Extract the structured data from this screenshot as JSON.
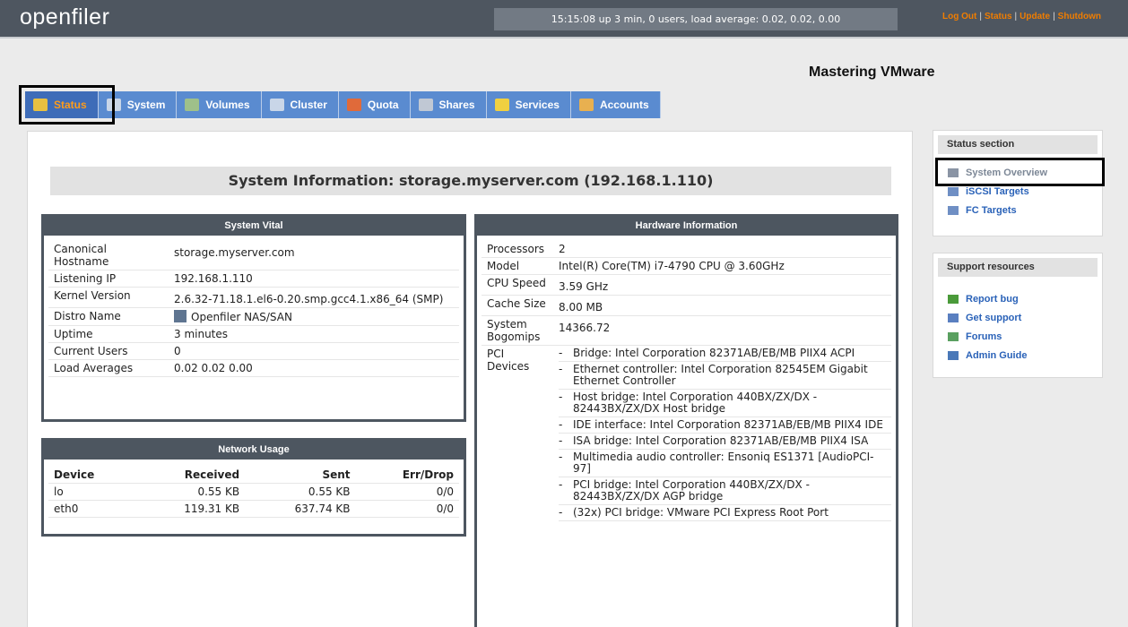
{
  "header": {
    "logo": "openfiler",
    "uptime": "15:15:08 up 3 min, 0 users, load average: 0.02, 0.02, 0.00",
    "links": [
      "Log Out",
      "Status",
      "Update",
      "Shutdown"
    ]
  },
  "page_title": "Mastering VMware",
  "tabs": [
    {
      "label": "Status",
      "icon": "status-icon",
      "color": "#e8c040"
    },
    {
      "label": "System",
      "icon": "system-icon",
      "color": "#c9d6e8"
    },
    {
      "label": "Volumes",
      "icon": "volumes-icon",
      "color": "#9fc08a"
    },
    {
      "label": "Cluster",
      "icon": "cluster-icon",
      "color": "#c9d6e8"
    },
    {
      "label": "Quota",
      "icon": "quota-icon",
      "color": "#e06a3a"
    },
    {
      "label": "Shares",
      "icon": "shares-icon",
      "color": "#c0c8d4"
    },
    {
      "label": "Services",
      "icon": "services-icon",
      "color": "#f0d040"
    },
    {
      "label": "Accounts",
      "icon": "accounts-icon",
      "color": "#e8b050"
    }
  ],
  "system_info_title": "System Information: storage.myserver.com (192.168.1.110)",
  "system_vital": {
    "title": "System Vital",
    "rows": [
      {
        "k": "Canonical Hostname",
        "v": "storage.myserver.com"
      },
      {
        "k": "Listening IP",
        "v": "192.168.1.110"
      },
      {
        "k": "Kernel Version",
        "v": "2.6.32-71.18.1.el6-0.20.smp.gcc4.1.x86_64 (SMP)"
      },
      {
        "k": "Distro Name",
        "v": "Openfiler NAS/SAN"
      },
      {
        "k": "Uptime",
        "v": "3 minutes"
      },
      {
        "k": "Current Users",
        "v": "0"
      },
      {
        "k": "Load Averages",
        "v": "0.02 0.02 0.00"
      }
    ]
  },
  "network_usage": {
    "title": "Network Usage",
    "headers": [
      "Device",
      "Received",
      "Sent",
      "Err/Drop"
    ],
    "rows": [
      [
        "lo",
        "0.55 KB",
        "0.55 KB",
        "0/0"
      ],
      [
        "eth0",
        "119.31 KB",
        "637.74 KB",
        "0/0"
      ]
    ]
  },
  "hardware": {
    "title": "Hardware Information",
    "rows": [
      {
        "k": "Processors",
        "v": "2"
      },
      {
        "k": "Model",
        "v": "Intel(R) Core(TM) i7-4790 CPU @ 3.60GHz"
      },
      {
        "k": "CPU Speed",
        "v": "3.59 GHz"
      },
      {
        "k": "Cache Size",
        "v": "8.00 MB"
      },
      {
        "k": "System Bogomips",
        "v": "14366.72"
      }
    ],
    "pci_label": "PCI Devices",
    "pci_devices": [
      "Bridge: Intel Corporation 82371AB/EB/MB PIIX4 ACPI",
      "Ethernet controller: Intel Corporation 82545EM Gigabit Ethernet Controller",
      "Host bridge: Intel Corporation 440BX/ZX/DX - 82443BX/ZX/DX Host bridge",
      "IDE interface: Intel Corporation 82371AB/EB/MB PIIX4 IDE",
      "ISA bridge: Intel Corporation 82371AB/EB/MB PIIX4 ISA",
      "Multimedia audio controller: Ensoniq ES1371 [AudioPCI-97]",
      "PCI bridge: Intel Corporation 440BX/ZX/DX - 82443BX/ZX/DX AGP bridge",
      "(32x) PCI bridge: VMware PCI Express Root Port"
    ]
  },
  "status_section": {
    "title": "Status section",
    "links": [
      {
        "label": "System Overview",
        "icon": "folder-icon",
        "color": "#8a94a4"
      },
      {
        "label": "iSCSI Targets",
        "icon": "folder-icon",
        "color": "#6f8fc4"
      },
      {
        "label": "FC Targets",
        "icon": "folder-icon",
        "color": "#6f8fc4"
      }
    ]
  },
  "support": {
    "title": "Support resources",
    "links": [
      {
        "label": "Report bug",
        "icon": "bug-icon",
        "color": "#4a9a3a"
      },
      {
        "label": "Get support",
        "icon": "support-icon",
        "color": "#5a7fc0"
      },
      {
        "label": "Forums",
        "icon": "forums-icon",
        "color": "#5aa060"
      },
      {
        "label": "Admin Guide",
        "icon": "guide-icon",
        "color": "#4a78b8"
      }
    ]
  }
}
